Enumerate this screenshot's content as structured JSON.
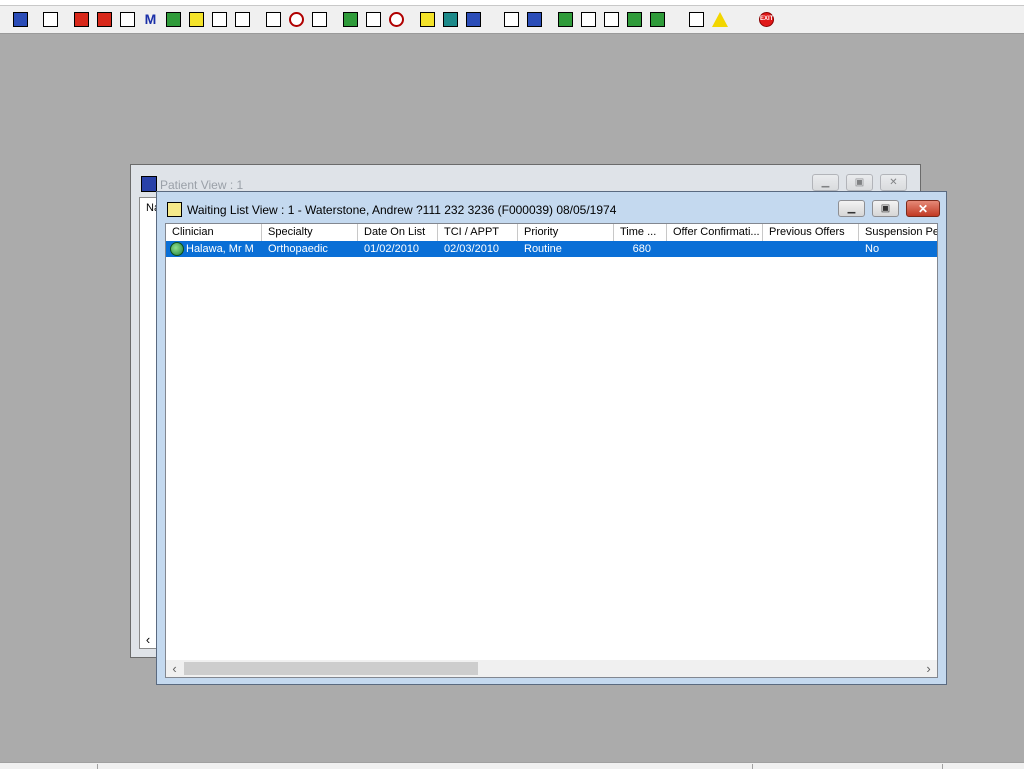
{
  "toolbar": {
    "buttons": [
      {
        "icon": "patient-icon"
      },
      {
        "icon": "printer-icon"
      },
      {
        "icon": "book-icon"
      },
      {
        "icon": "folder-edit-icon"
      },
      {
        "icon": "report-icon"
      },
      {
        "icon": "m-icon",
        "glyph": "M"
      },
      {
        "icon": "doctor-icon"
      },
      {
        "icon": "notes-icon"
      },
      {
        "icon": "ambulance-icon"
      },
      {
        "icon": "transport-icon"
      },
      {
        "icon": "search-doc-icon"
      },
      {
        "icon": "clock-icon"
      },
      {
        "icon": "monitor-icon"
      },
      {
        "icon": "screen-icon"
      },
      {
        "icon": "edit-screen-icon"
      },
      {
        "icon": "target-icon"
      },
      {
        "icon": "list-icon"
      },
      {
        "icon": "bed-icon"
      },
      {
        "icon": "person-bed-icon"
      },
      {
        "icon": "page-icon"
      },
      {
        "icon": "chart-icon"
      },
      {
        "icon": "globe-icon"
      },
      {
        "icon": "check-doc-icon"
      },
      {
        "icon": "arrow-doc-icon"
      },
      {
        "icon": "green-arrow-icon"
      },
      {
        "icon": "refresh-icon"
      },
      {
        "icon": "transfer-icon"
      },
      {
        "icon": "warning-icon"
      },
      {
        "icon": "exit-icon",
        "glyph": "EXIT"
      }
    ]
  },
  "patient_window": {
    "title": "Patient View : 1",
    "na_text": "Na"
  },
  "waiting_window": {
    "title": "Waiting List View :  1 - Waterstone, Andrew ?111 232 3236 (F000039) 08/05/1974",
    "columns": [
      "Clinician",
      "Specialty",
      "Date On List",
      "TCI / APPT",
      "Priority",
      "Time ...",
      "Offer Confirmati...",
      "Previous Offers",
      "Suspension Pe"
    ],
    "rows": [
      {
        "clinician": "Halawa, Mr M",
        "specialty": "Orthopaedic",
        "date_on_list": "01/02/2010",
        "tci_appt": "02/03/2010",
        "priority": "Routine",
        "time": "680",
        "offer_confirmation": "",
        "previous_offers": "",
        "suspension": "No"
      }
    ]
  },
  "colors": {
    "desktop": "#ababab",
    "selection": "#0a6fd6",
    "title_active": "#c4d9ef",
    "close_button": "#c13a24"
  }
}
